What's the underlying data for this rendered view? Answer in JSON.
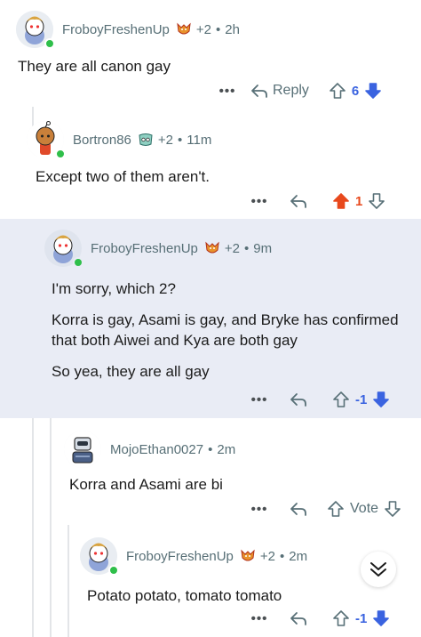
{
  "colors": {
    "upvote_active": "#e8491d",
    "downvote_active": "#3a63e0",
    "muted_text": "#576f76",
    "highlight_bg": "#e9ecf5",
    "online": "#2fbf4a"
  },
  "comments": [
    {
      "username": "FroboyFreshenUp",
      "flair_icon": "wolf-flair-icon",
      "plus": "+2",
      "time": "2h",
      "body": [
        "They are all canon gay"
      ],
      "reply_label": "Reply",
      "score": "6",
      "vote_state": "down"
    },
    {
      "username": "Bortron86",
      "flair_icon": "eyes-flair-icon",
      "plus": "+2",
      "time": "11m",
      "body": [
        "Except two of them aren't."
      ],
      "score": "1",
      "vote_state": "up"
    },
    {
      "username": "FroboyFreshenUp",
      "flair_icon": "wolf-flair-icon",
      "plus": "+2",
      "time": "9m",
      "body": [
        "I'm sorry, which 2?",
        "Korra is gay, Asami is gay, and Bryke has confirmed that both Aiwei and Kya are both gay",
        "So yea, they are all gay"
      ],
      "score": "-1",
      "vote_state": "down"
    },
    {
      "username": "MojoEthan0027",
      "time": "2m",
      "body": [
        "Korra and Asami are bi"
      ],
      "vote_label": "Vote",
      "vote_state": "none"
    },
    {
      "username": "FroboyFreshenUp",
      "flair_icon": "wolf-flair-icon",
      "plus": "+2",
      "time": "2m",
      "body": [
        "Potato potato, tomato tomato"
      ],
      "score": "-1",
      "vote_state": "down"
    }
  ],
  "more_label": "•••"
}
